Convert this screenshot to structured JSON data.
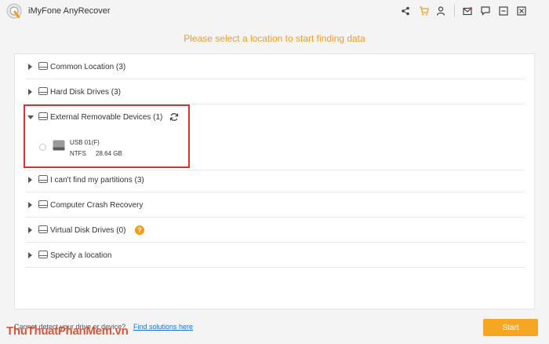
{
  "app": {
    "title": "iMyFone AnyRecover"
  },
  "toolbar": {
    "icons": [
      "share-icon",
      "cart-icon",
      "user-icon",
      "mail-icon",
      "feedback-icon",
      "minimize-icon",
      "close-icon"
    ],
    "cart_color": "#f39b1a"
  },
  "subtitle": "Please select a location to start finding data",
  "locations": [
    {
      "label": "Common Location (3)"
    },
    {
      "label": "Hard Disk Drives (3)"
    },
    {
      "label": "External Removable Devices (1)"
    },
    {
      "label": "I can't find my partitions (3)"
    },
    {
      "label": "Computer Crash Recovery"
    },
    {
      "label": "Virtual Disk Drives (0)"
    },
    {
      "label": "Specify a location"
    }
  ],
  "device": {
    "name": "USB 01(F)",
    "filesystem": "NTFS",
    "size": "28.64 GB"
  },
  "help_badge": "?",
  "footer": {
    "question": "Cannot detect your drive or device?",
    "link": "Find solutions here",
    "start_label": "Start"
  },
  "watermark": "ThuThuatPhanMem.vn",
  "colors": {
    "accent": "#f39b1a",
    "highlight": "#e03030",
    "link": "#1c6fd1"
  }
}
